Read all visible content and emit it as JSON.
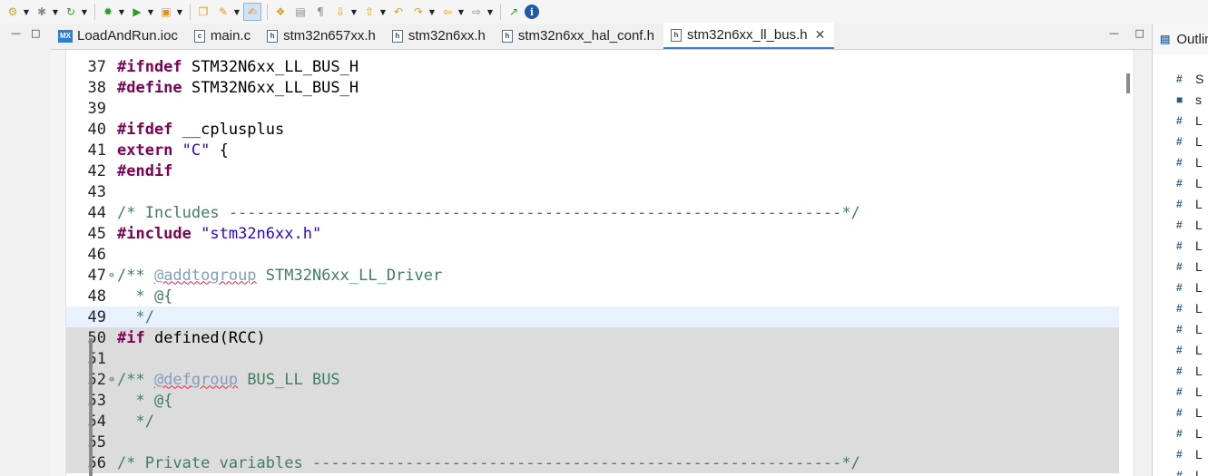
{
  "toolbar": {
    "buttons": [
      {
        "name": "build-icon",
        "glyph": "⚙"
      },
      {
        "name": "new-icon",
        "glyph": "✱"
      },
      {
        "name": "refresh-icon",
        "glyph": "↻"
      },
      {
        "name": "debug-icon",
        "glyph": "✹"
      },
      {
        "name": "run-icon",
        "glyph": "▶"
      },
      {
        "name": "external-tools-icon",
        "glyph": "▣"
      },
      {
        "name": "open-folder-icon",
        "glyph": "❐"
      },
      {
        "name": "wand-icon",
        "glyph": "✎"
      },
      {
        "name": "highlight-icon",
        "glyph": "✍"
      },
      {
        "name": "toggle-mark-icon",
        "glyph": "❖"
      },
      {
        "name": "block-selection-icon",
        "glyph": "▤"
      },
      {
        "name": "pilcrow-icon",
        "glyph": "¶"
      },
      {
        "name": "next-annotation-icon",
        "glyph": "⇩"
      },
      {
        "name": "prev-annotation-icon",
        "glyph": "⇧"
      },
      {
        "name": "last-edit-icon",
        "glyph": "↶"
      },
      {
        "name": "next-edit-icon",
        "glyph": "↷"
      },
      {
        "name": "back-icon",
        "glyph": "⇦"
      },
      {
        "name": "forward-icon",
        "glyph": "⇨"
      },
      {
        "name": "pin-editor-icon",
        "glyph": "↗"
      },
      {
        "name": "info-icon",
        "glyph": "i"
      }
    ]
  },
  "tabs": [
    {
      "label": "LoadAndRun.ioc",
      "icon": "mx-icon",
      "active": false
    },
    {
      "label": "main.c",
      "icon": "c-file-icon",
      "active": false
    },
    {
      "label": "stm32n657xx.h",
      "icon": "h-file-icon",
      "active": false
    },
    {
      "label": "stm32n6xx.h",
      "icon": "h-file-icon",
      "active": false
    },
    {
      "label": "stm32n6xx_hal_conf.h",
      "icon": "h-file-icon",
      "active": false
    },
    {
      "label": "stm32n6xx_ll_bus.h",
      "icon": "h-file-icon",
      "active": true
    }
  ],
  "editor": {
    "lines": [
      {
        "n": "37",
        "parts": [
          [
            "kw",
            "#ifndef"
          ],
          [
            "plain",
            " STM32N6xx_LL_BUS_H"
          ]
        ]
      },
      {
        "n": "38",
        "parts": [
          [
            "kw",
            "#define"
          ],
          [
            "plain",
            " STM32N6xx_LL_BUS_H"
          ]
        ]
      },
      {
        "n": "39",
        "parts": []
      },
      {
        "n": "40",
        "parts": [
          [
            "kw",
            "#ifdef"
          ],
          [
            "plain",
            " __cplusplus"
          ]
        ]
      },
      {
        "n": "41",
        "parts": [
          [
            "kw",
            "extern"
          ],
          [
            "plain",
            " "
          ],
          [
            "str",
            "\"C\""
          ],
          [
            "plain",
            " {"
          ]
        ]
      },
      {
        "n": "42",
        "parts": [
          [
            "kw",
            "#endif"
          ]
        ]
      },
      {
        "n": "43",
        "parts": []
      },
      {
        "n": "44",
        "parts": [
          [
            "cmt",
            "/* Includes ------------------------------------------------------------------*/"
          ]
        ]
      },
      {
        "n": "45",
        "parts": [
          [
            "kw",
            "#include"
          ],
          [
            "plain",
            " "
          ],
          [
            "str",
            "\"stm32n6xx.h\""
          ]
        ]
      },
      {
        "n": "46",
        "parts": []
      },
      {
        "n": "47",
        "fold": true,
        "parts": [
          [
            "cmt",
            "/** "
          ],
          [
            "tag",
            "@addtogroup"
          ],
          [
            "cmt",
            " STM32N6xx_LL_Driver"
          ]
        ]
      },
      {
        "n": "48",
        "parts": [
          [
            "cmt",
            "  * @{"
          ]
        ]
      },
      {
        "n": "49",
        "cur": true,
        "parts": [
          [
            "cmt",
            "  */"
          ]
        ]
      },
      {
        "n": "50",
        "inactive": true,
        "parts": [
          [
            "kw",
            "#if"
          ],
          [
            "plain",
            " defined(RCC)"
          ]
        ]
      },
      {
        "n": "51",
        "inactive": true,
        "parts": []
      },
      {
        "n": "52",
        "fold": true,
        "inactive": true,
        "parts": [
          [
            "cmt",
            "/** "
          ],
          [
            "tag",
            "@defgroup"
          ],
          [
            "cmt",
            " BUS_LL BUS"
          ]
        ]
      },
      {
        "n": "53",
        "inactive": true,
        "parts": [
          [
            "cmt",
            "  * @{"
          ]
        ]
      },
      {
        "n": "54",
        "inactive": true,
        "parts": [
          [
            "cmt",
            "  */"
          ]
        ]
      },
      {
        "n": "55",
        "inactive": true,
        "parts": []
      },
      {
        "n": "56",
        "inactive": true,
        "parts": [
          [
            "cmt",
            "/* Private variables ---------------------------------------------------------*/"
          ]
        ]
      }
    ]
  },
  "outline": {
    "title": "Outlin",
    "items": [
      {
        "icon": "#",
        "label": "S"
      },
      {
        "icon": "■",
        "label": "s"
      },
      {
        "icon": "#",
        "label": "L"
      },
      {
        "icon": "#",
        "label": "L"
      },
      {
        "icon": "#",
        "label": "L"
      },
      {
        "icon": "#",
        "label": "L"
      },
      {
        "icon": "#",
        "label": "L"
      },
      {
        "icon": "#",
        "label": "L"
      },
      {
        "icon": "#",
        "label": "L"
      },
      {
        "icon": "#",
        "label": "L"
      },
      {
        "icon": "#",
        "label": "L"
      },
      {
        "icon": "#",
        "label": "L"
      },
      {
        "icon": "#",
        "label": "L"
      },
      {
        "icon": "#",
        "label": "L"
      },
      {
        "icon": "#",
        "label": "L"
      },
      {
        "icon": "#",
        "label": "L"
      },
      {
        "icon": "#",
        "label": "L"
      },
      {
        "icon": "#",
        "label": "L"
      },
      {
        "icon": "#",
        "label": "L"
      },
      {
        "icon": "#",
        "label": "L"
      }
    ]
  }
}
